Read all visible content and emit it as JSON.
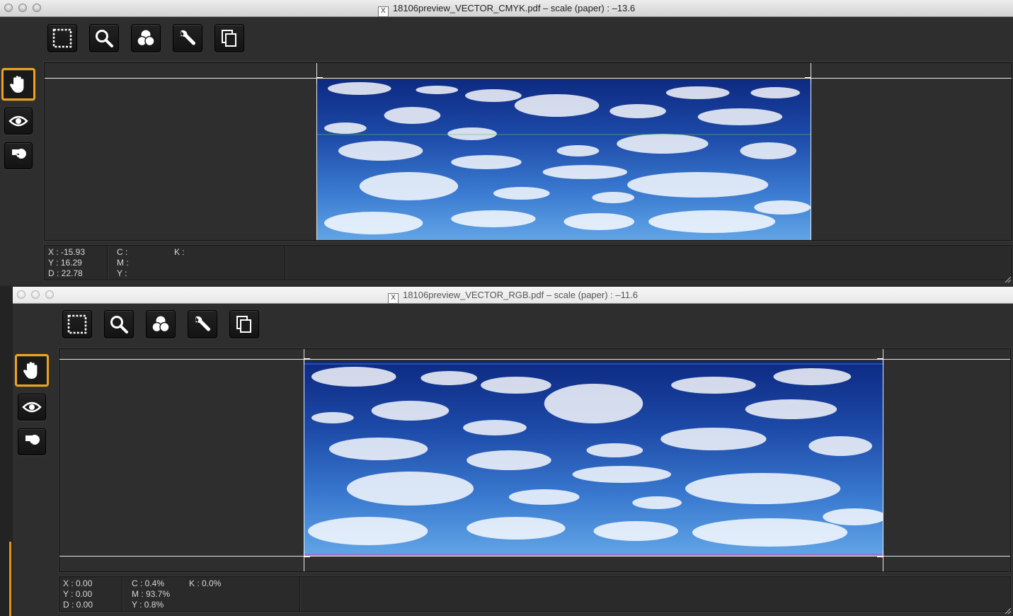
{
  "windows": [
    {
      "title": "18106preview_VECTOR_CMYK.pdf – scale (paper) : –13.6",
      "toolbar": [
        "select-marquee-icon",
        "magnifier-icon",
        "color-separations-icon",
        "wrench-icon",
        "pages-icon"
      ],
      "sidebar": [
        "hand-icon",
        "eye-icon",
        "overlay-icon"
      ],
      "status": {
        "x": "X : -15.93",
        "y": "Y : 16.29",
        "d": "D : 22.78",
        "c": "C :",
        "m": "M :",
        "y2": "Y :",
        "k": "K :"
      }
    },
    {
      "title": "18106preview_VECTOR_RGB.pdf – scale (paper) : –11.6",
      "toolbar": [
        "select-marquee-icon",
        "magnifier-icon",
        "color-separations-icon",
        "wrench-icon",
        "pages-icon"
      ],
      "sidebar": [
        "hand-icon",
        "eye-icon",
        "overlay-icon"
      ],
      "status": {
        "x": "X : 0.00",
        "y": "Y : 0.00",
        "d": "D : 0.00",
        "c": "C : 0.4%",
        "m": "M : 93.7%",
        "y2": "Y : 0.8%",
        "k": "K : 0.0%"
      }
    }
  ],
  "colors": {
    "accent": "#f0a21a",
    "panel": "#2e2e2e",
    "sky_top": "#0d2a82",
    "sky_bottom": "#62a5e6"
  }
}
